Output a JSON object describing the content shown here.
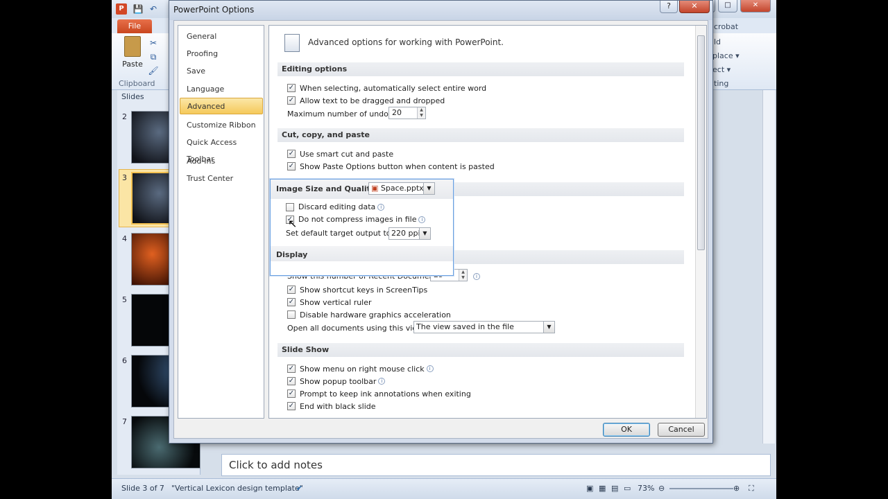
{
  "app": {
    "file_tab": "File",
    "paste": "Paste",
    "clipboard": "Clipboard",
    "slides_tab": "Slides",
    "ribbon_right": [
      "crobat",
      "ld",
      "place ▾",
      "ect ▾",
      "ting"
    ],
    "thumb_numbers": [
      "2",
      "3",
      "4",
      "5",
      "6",
      "7"
    ],
    "notes_placeholder": "Click to add notes",
    "status": {
      "slide": "Slide 3 of 7",
      "theme": "\"Vertical Lexicon design template\"",
      "zoom": "73%"
    }
  },
  "dialog": {
    "title": "PowerPoint Options",
    "help": "?",
    "close": "✕",
    "nav": [
      "General",
      "Proofing",
      "Save",
      "Language",
      "Advanced",
      "Customize Ribbon",
      "Quick Access Toolbar",
      "Add-Ins",
      "Trust Center"
    ],
    "selected_nav": "Advanced",
    "header": "Advanced options for working with PowerPoint.",
    "sections": {
      "editing": {
        "title": "Editing options",
        "opt1": "When selecting, automatically select entire word",
        "opt2": "Allow text to be dragged and dropped",
        "undo_label": "Maximum number of undos:",
        "undo_value": "20"
      },
      "ccp": {
        "title": "Cut, copy, and paste",
        "opt1": "Use smart cut and paste",
        "opt2": "Show Paste Options button when content is pasted"
      },
      "image": {
        "title": "Image Size and Quality",
        "file": "Space.pptx",
        "opt1": "Discard editing data",
        "opt2": "Do not compress images in file",
        "target_label": "Set default target output to:",
        "target_value": "220 ppi"
      },
      "display": {
        "title": "Display",
        "recent_label": "Show this number of Recent Documents:",
        "recent_value": "25",
        "opt1": "Show shortcut keys in ScreenTips",
        "opt2": "Show vertical ruler",
        "opt3": "Disable hardware graphics acceleration",
        "open_label": "Open all documents using this view",
        "open_value": "The view saved in the file"
      },
      "slideshow": {
        "title": "Slide Show",
        "opt1": "Show menu on right mouse click",
        "opt2": "Show popup toolbar",
        "opt3": "Prompt to keep ink annotations when exiting",
        "opt4": "End with black slide"
      }
    },
    "ok": "OK",
    "cancel": "Cancel",
    "checkmark": "✓"
  }
}
